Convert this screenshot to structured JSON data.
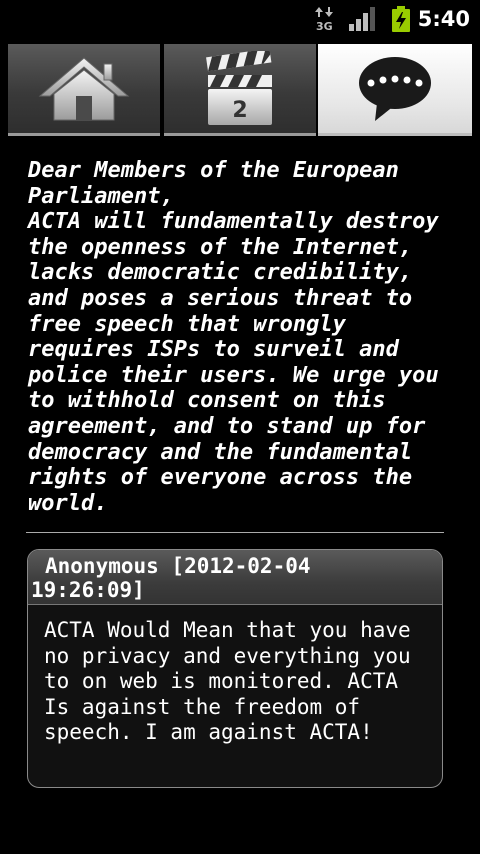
{
  "status_bar": {
    "network_label": "3G",
    "time": "5:40",
    "icons": [
      "network-3g-icon",
      "signal-strength-icon",
      "battery-charging-icon"
    ],
    "battery_color": "#99cc00"
  },
  "tabs": [
    {
      "icon": "home-icon",
      "active": false
    },
    {
      "icon": "clapperboard-icon",
      "badge": "2",
      "active": false
    },
    {
      "icon": "speech-bubble-icon",
      "active": true
    }
  ],
  "letter": {
    "text": "Dear Members of the European Parliament,\nACTA will fundamentally destroy the openness of the Internet, lacks democratic credibility, and poses a serious threat to free speech that wrongly requires ISPs to surveil and police their users. We urge you to withhold consent on this agreement, and to stand up for democracy and the fundamental rights of everyone across the world."
  },
  "comment": {
    "author_line": "Anonymous [2012-02-04 19:26:09]",
    "body": "ACTA Would Mean that you have no privacy and everything you to on web is monitored. ACTA Is against the freedom of speech. I am against ACTA!"
  }
}
